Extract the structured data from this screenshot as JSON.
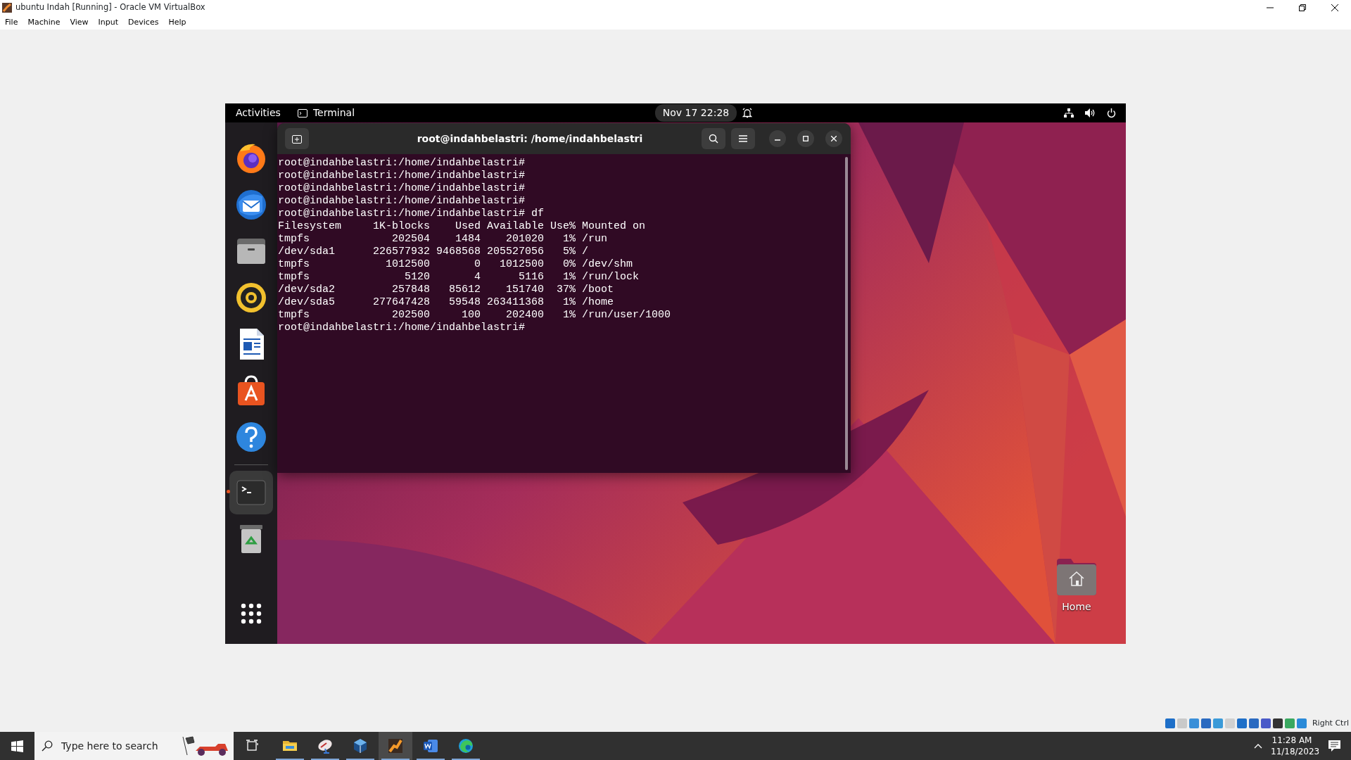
{
  "window": {
    "title": "ubuntu Indah [Running] - Oracle VM VirtualBox"
  },
  "menu": [
    "File",
    "Machine",
    "View",
    "Input",
    "Devices",
    "Help"
  ],
  "top_bar": {
    "activities": "Activities",
    "app": "Terminal",
    "clock": "Nov 17  22:28"
  },
  "dock": [
    {
      "kind": "firefox",
      "selected": false
    },
    {
      "kind": "mail",
      "selected": false
    },
    {
      "kind": "files",
      "selected": false
    },
    {
      "kind": "music",
      "selected": false
    },
    {
      "kind": "writer",
      "selected": false
    },
    {
      "kind": "software",
      "selected": false
    },
    {
      "kind": "help",
      "selected": false
    },
    {
      "kind": "terminal",
      "selected": true
    },
    {
      "kind": "trash",
      "selected": false
    }
  ],
  "terminal": {
    "title": "root@indahbelastri: /home/indahbelastri",
    "lines": [
      "root@indahbelastri:/home/indahbelastri#",
      "root@indahbelastri:/home/indahbelastri#",
      "root@indahbelastri:/home/indahbelastri#",
      "root@indahbelastri:/home/indahbelastri#",
      "root@indahbelastri:/home/indahbelastri# df",
      "Filesystem     1K-blocks    Used Available Use% Mounted on",
      "tmpfs             202504    1484    201020   1% /run",
      "/dev/sda1      226577932 9468568 205527056   5% /",
      "tmpfs            1012500       0   1012500   0% /dev/shm",
      "tmpfs               5120       4      5116   1% /run/lock",
      "/dev/sda2         257848   85612    151740  37% /boot",
      "/dev/sda5      277647428   59548 263411368   1% /home",
      "tmpfs             202500     100    202400   1% /run/user/1000",
      "root@indahbelastri:/home/indahbelastri#"
    ]
  },
  "desktop": {
    "home_label": "Home"
  },
  "status_bar": {
    "host_key": "Right Ctrl"
  },
  "taskbar": {
    "search": {
      "placeholder": "Type here to search"
    },
    "apps": [
      {
        "kind": "explorer",
        "selected": false
      },
      {
        "kind": "network",
        "selected": false
      },
      {
        "kind": "box",
        "selected": false
      },
      {
        "kind": "paint",
        "selected": true
      },
      {
        "kind": "word",
        "selected": false
      },
      {
        "kind": "edge",
        "selected": false
      }
    ],
    "time": "11:28 AM",
    "date": "11/18/2023"
  }
}
